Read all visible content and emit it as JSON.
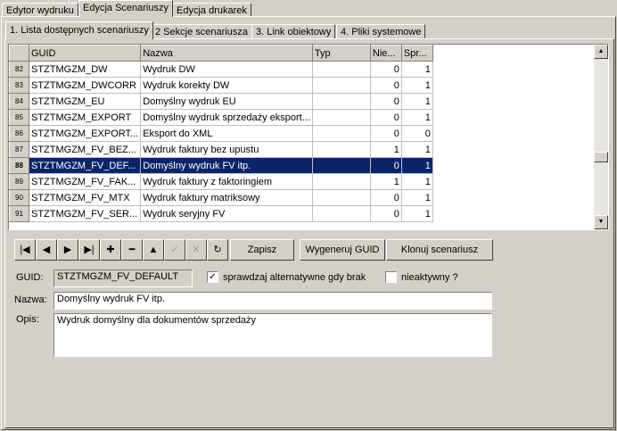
{
  "top_tabs": [
    "Edytor wydruku",
    "Edycja Scenariuszy",
    "Edycja drukarek"
  ],
  "sub_tabs": [
    "1. Lista dostępnych scenariuszy",
    "2 Sekcje scenariusza",
    "3. Link obiektowy",
    "4. Pliki systemowe"
  ],
  "grid": {
    "columns": [
      "GUID",
      "Nazwa",
      "Typ",
      "Nie...",
      "Spr..."
    ],
    "rows": [
      {
        "n": "82",
        "guid": "STZTMGZM_DW",
        "nazwa": "Wydruk DW",
        "typ": "",
        "nie": "0",
        "spr": "1"
      },
      {
        "n": "83",
        "guid": "STZTMGZM_DWCORR",
        "nazwa": "Wydruk korekty DW",
        "typ": "",
        "nie": "0",
        "spr": "1"
      },
      {
        "n": "84",
        "guid": "STZTMGZM_EU",
        "nazwa": "Domyślny wydruk EU",
        "typ": "",
        "nie": "0",
        "spr": "1"
      },
      {
        "n": "85",
        "guid": "STZTMGZM_EXPORT",
        "nazwa": "Domyślny wydruk sprzedaży eksport...",
        "typ": "",
        "nie": "0",
        "spr": "1"
      },
      {
        "n": "86",
        "guid": "STZTMGZM_EXPORT...",
        "nazwa": "Eksport do XML",
        "typ": "",
        "nie": "0",
        "spr": "0"
      },
      {
        "n": "87",
        "guid": "STZTMGZM_FV_BEZ...",
        "nazwa": "Wydruk faktury bez upustu",
        "typ": "",
        "nie": "1",
        "spr": "1"
      },
      {
        "n": "88",
        "guid": "STZTMGZM_FV_DEF...",
        "nazwa": "Domyślny wydruk FV itp.",
        "typ": "",
        "nie": "0",
        "spr": "1",
        "selected": true
      },
      {
        "n": "89",
        "guid": "STZTMGZM_FV_FAK...",
        "nazwa": "Wydruk faktury z faktoringiem",
        "typ": "",
        "nie": "1",
        "spr": "1"
      },
      {
        "n": "90",
        "guid": "STZTMGZM_FV_MTX",
        "nazwa": "Wydruk faktury matriksowy",
        "typ": "",
        "nie": "0",
        "spr": "1"
      },
      {
        "n": "91",
        "guid": "STZTMGZM_FV_SER...",
        "nazwa": "Wydruk seryjny FV",
        "typ": "",
        "nie": "0",
        "spr": "1"
      }
    ]
  },
  "toolbar": {
    "nav": [
      "|◀",
      "◀",
      "▶",
      "▶|",
      "✚",
      "━",
      "▲",
      "✓",
      "✕",
      "↻"
    ],
    "save": "Zapisz",
    "generate_guid": "Wygeneruj GUID",
    "clone": "Klonuj scenariusz"
  },
  "form": {
    "guid_label": "GUID:",
    "guid_value": "STZTMGZM_FV_DEFAULT",
    "check_alt_label": "sprawdzaj alternatywne gdy brak",
    "check_alt_mark": "✓",
    "check_inactive_label": "nieaktywny ?",
    "nazwa_label": "Nazwa:",
    "nazwa_value": "Domyślny wydruk FV itp.",
    "opis_label": "Opis:",
    "opis_value": "Wydruk domyślny dla dokumentów sprzedaży"
  }
}
